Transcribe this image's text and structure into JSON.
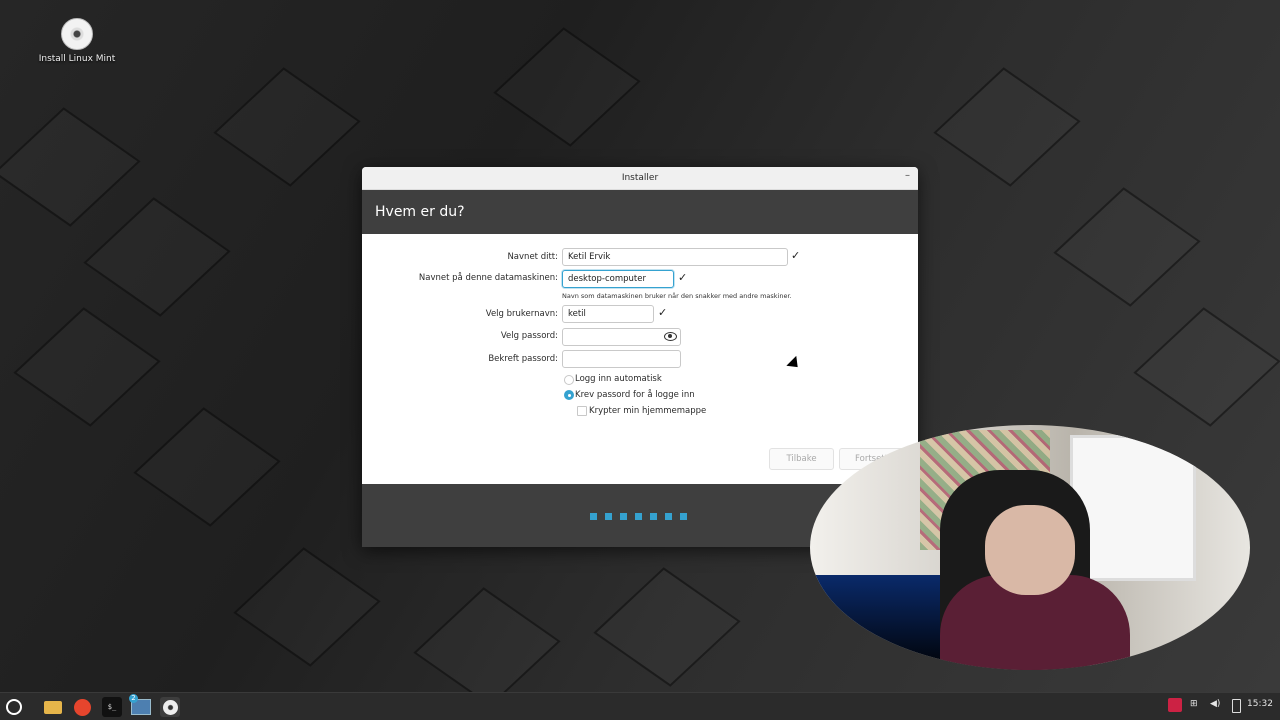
{
  "desktop": {
    "icon_label": "Install Linux Mint"
  },
  "window": {
    "title": "Installer",
    "minimize_glyph": "–",
    "heading": "Hvem er du?",
    "form": {
      "name_label": "Navnet ditt:",
      "name_value": "Ketil Ervik",
      "computer_label": "Navnet på denne datamaskinen:",
      "computer_value": "desktop-computer",
      "computer_hint": "Navn som datamaskinen bruker når den snakker med andre maskiner.",
      "username_label": "Velg brukernavn:",
      "username_value": "ketil",
      "password_label": "Velg passord:",
      "password_value": "",
      "confirm_label": "Bekreft passord:",
      "confirm_value": "",
      "check_glyph": "✓",
      "options": {
        "auto_login": "Logg inn automatisk",
        "require_password": "Krev passord for å logge inn",
        "encrypt_home": "Krypter min hjemmemappe"
      },
      "selected_option": "require_password"
    },
    "buttons": {
      "back": "Tilbake",
      "continue": "Fortsett"
    },
    "progress": {
      "total_steps": 7,
      "color": "#35a2d0"
    }
  },
  "taskbar": {
    "clock": "15:32",
    "workspace_badge": "2",
    "terminal_glyph": "$_",
    "items": [
      "menu-icon",
      "files-icon",
      "firefox-icon",
      "terminal-icon",
      "workspace-icon",
      "installer-icon"
    ],
    "tray": [
      "flag-icon",
      "network-icon",
      "volume-icon",
      "battery-icon"
    ]
  },
  "colors": {
    "accent": "#35a2d0",
    "header_bg": "#3f3f3f",
    "taskbar_bg": "#2b2b2b"
  }
}
